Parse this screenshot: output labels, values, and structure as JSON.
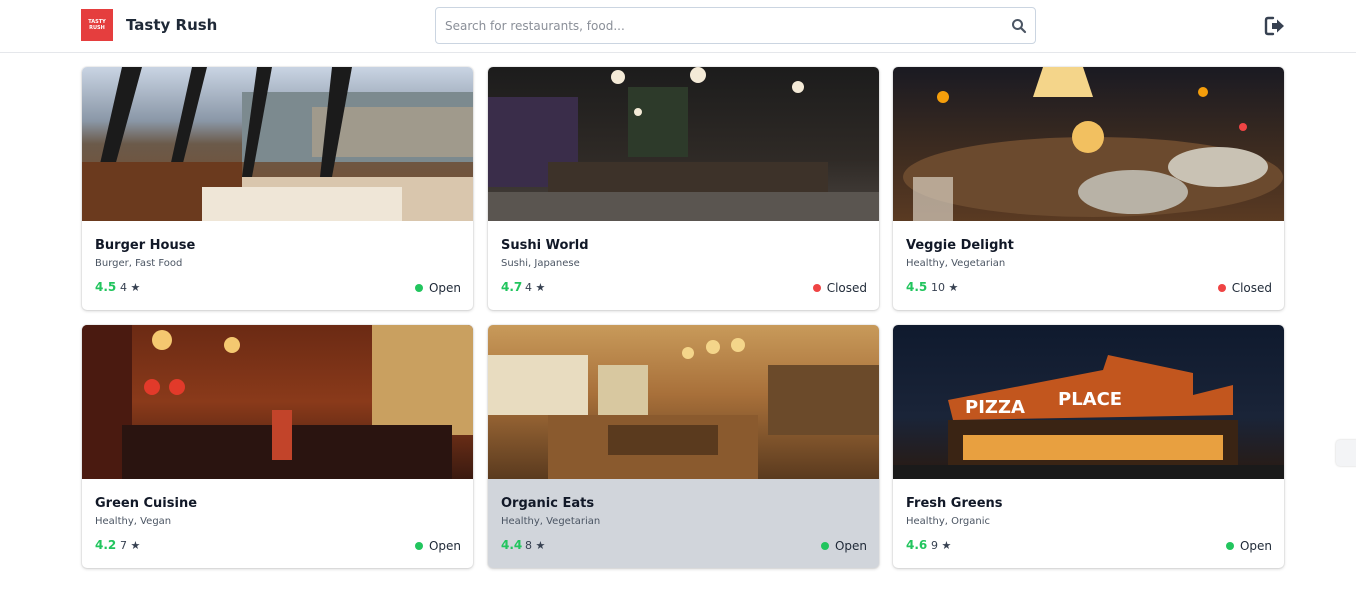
{
  "header": {
    "logo_text": "TASTY RUSH",
    "app_title": "Tasty Rush",
    "search_placeholder": "Search for restaurants, food...",
    "search_value": ""
  },
  "colors": {
    "brand": "#e53e3e",
    "rating": "#22c55e",
    "open": "#22c55e",
    "closed": "#ef4444"
  },
  "restaurants": [
    {
      "name": "Burger House",
      "cuisine": "Burger, Fast Food",
      "rating": "4.5",
      "reviews": "4 ★",
      "status": "Open",
      "status_color": "#22c55e",
      "image": "restaurant-photo"
    },
    {
      "name": "Sushi World",
      "cuisine": "Sushi, Japanese",
      "rating": "4.7",
      "reviews": "4 ★",
      "status": "Closed",
      "status_color": "#ef4444",
      "image": "restaurant-photo"
    },
    {
      "name": "Veggie Delight",
      "cuisine": "Healthy, Vegetarian",
      "rating": "4.5",
      "reviews": "10 ★",
      "status": "Closed",
      "status_color": "#ef4444",
      "image": "restaurant-photo"
    },
    {
      "name": "Green Cuisine",
      "cuisine": "Healthy, Vegan",
      "rating": "4.2",
      "reviews": "7 ★",
      "status": "Open",
      "status_color": "#22c55e",
      "image": "restaurant-photo"
    },
    {
      "name": "Organic Eats",
      "cuisine": "Healthy, Vegetarian",
      "rating": "4.4",
      "reviews": "8 ★",
      "status": "Open",
      "status_color": "#22c55e",
      "image": "restaurant-photo"
    },
    {
      "name": "Fresh Greens",
      "cuisine": "Healthy, Organic",
      "rating": "4.6",
      "reviews": "9 ★",
      "status": "Open",
      "status_color": "#22c55e",
      "image": "restaurant-photo"
    }
  ]
}
